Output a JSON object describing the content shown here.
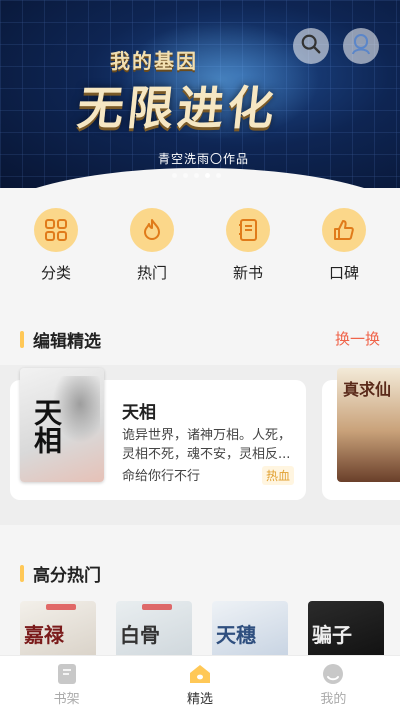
{
  "banner": {
    "subtitle": "我的基因",
    "title": "无限进化",
    "author": "青空洗雨〇作品"
  },
  "header": {
    "search_icon": "search-icon",
    "user_icon": "user-icon"
  },
  "categories": [
    {
      "label": "分类",
      "icon": "grid-icon"
    },
    {
      "label": "热门",
      "icon": "flame-icon"
    },
    {
      "label": "新书",
      "icon": "book-icon"
    },
    {
      "label": "口碑",
      "icon": "thumbs-up-icon"
    }
  ],
  "editor_pick": {
    "title": "编辑精选",
    "refresh_label": "换一换",
    "book": {
      "cover_text": "天相",
      "title": "天相",
      "description": "诡异世界，诸神万相。人死，灵相不死，魂不安，灵相反...",
      "author": "命给你行不行",
      "tag": "热血"
    },
    "next_cover_text": "真求仙"
  },
  "hot": {
    "title": "高分热门",
    "covers": [
      "嘉禄",
      "白骨",
      "天穗",
      "骗子"
    ]
  },
  "tabbar": [
    {
      "label": "书架",
      "icon": "bookshelf-icon",
      "active": false
    },
    {
      "label": "精选",
      "icon": "home-icon",
      "active": true
    },
    {
      "label": "我的",
      "icon": "profile-icon",
      "active": false
    }
  ],
  "colors": {
    "accent": "#ffc857",
    "icon_bg": "#fbd78a",
    "refresh": "#f0644a"
  }
}
